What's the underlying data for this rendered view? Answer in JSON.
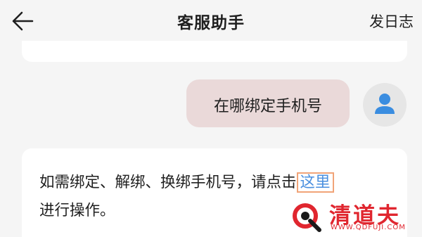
{
  "header": {
    "title": "客服助手",
    "log_button": "发日志"
  },
  "messages": [
    {
      "role": "user",
      "text": "在哪绑定手机号"
    },
    {
      "role": "assistant",
      "text_before": "如需绑定、解绑、换绑手机号，请点击",
      "link": "这里",
      "text_after": "进行操作。"
    }
  ],
  "icons": {
    "back": "back-arrow-icon",
    "avatar": "user-avatar-icon"
  },
  "watermark": {
    "brand": "清道夫",
    "url": "WWW.QDFUJI.COM"
  },
  "colors": {
    "link": "#4a8fdf",
    "user_bubble": "#ead9d9",
    "highlight_box": "#f1a478",
    "watermark": "#e0262f"
  }
}
